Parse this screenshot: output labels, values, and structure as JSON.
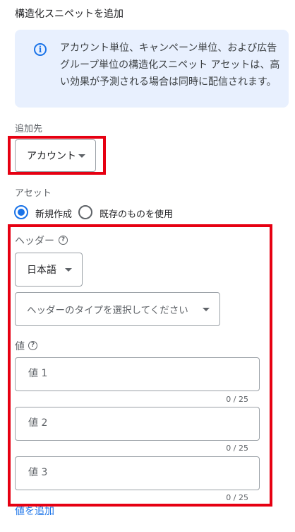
{
  "title": "構造化スニペットを追加",
  "info": {
    "icon": "info-icon",
    "text": "アカウント単位、キャンペーン単位、および広告グループ単位の構造化スニペット アセットは、高い効果が予測される場合は同時に配信されます。"
  },
  "add_to": {
    "label": "追加先",
    "value": "アカウント"
  },
  "asset": {
    "label": "アセット",
    "options": [
      {
        "label": "新規作成",
        "selected": true
      },
      {
        "label": "既存のものを使用",
        "selected": false
      }
    ]
  },
  "header": {
    "label": "ヘッダー",
    "language": "日本語",
    "type_placeholder": "ヘッダーのタイプを選択してください"
  },
  "values": {
    "label": "値",
    "fields": [
      {
        "placeholder": "値 1",
        "counter": "0 / 25"
      },
      {
        "placeholder": "値 2",
        "counter": "0 / 25"
      },
      {
        "placeholder": "値 3",
        "counter": "0 / 25"
      }
    ],
    "add_label": "値を追加"
  },
  "colors": {
    "accent": "#1a73e8",
    "highlight": "#e60012",
    "info_bg": "#e8f0fe"
  }
}
